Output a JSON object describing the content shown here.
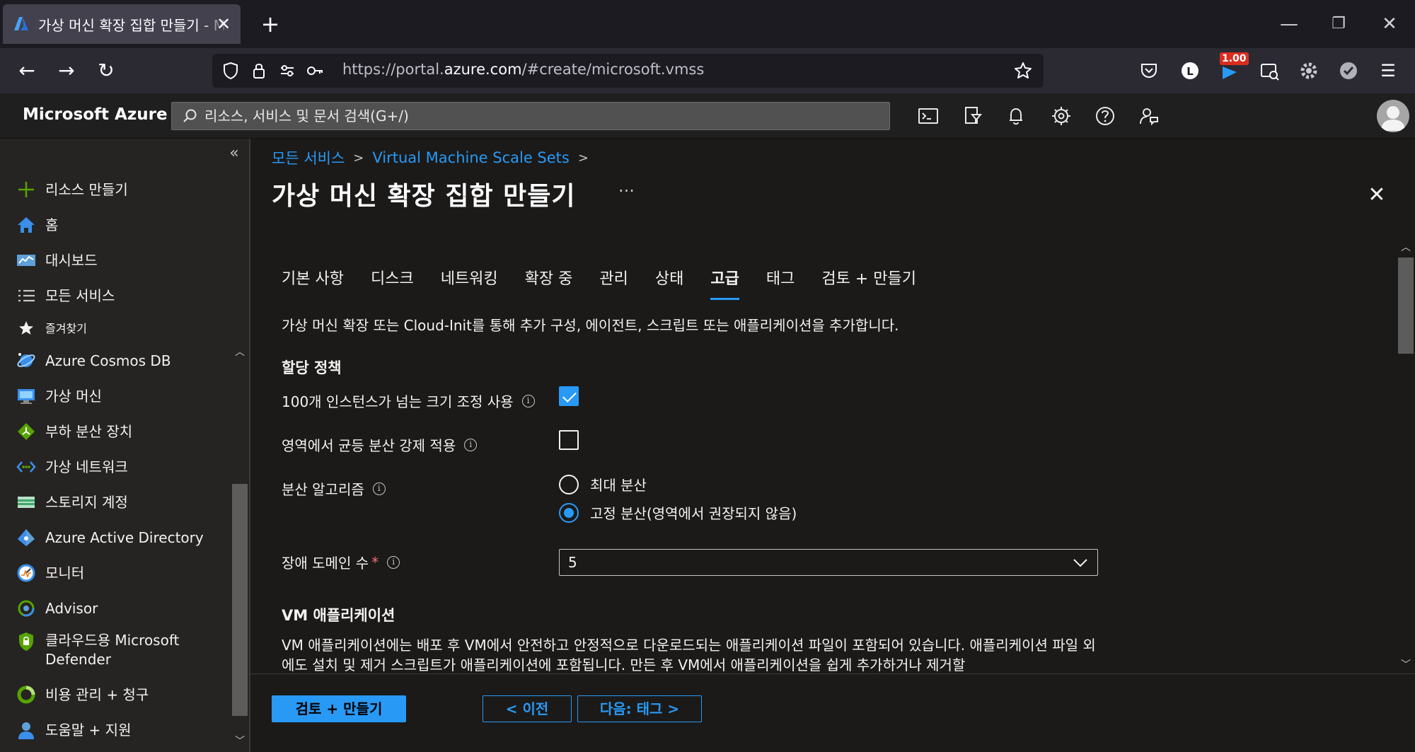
{
  "browser": {
    "tab_title": "가상 머신 확장 집합 만들기 - Microsoft Azure",
    "new_tab_label": "+",
    "url_prefix": "https://portal.",
    "url_domain": "azure.com",
    "url_path": "/#create/microsoft.vmss",
    "badge_value": "1.00"
  },
  "azure": {
    "brand": "Microsoft Azure",
    "search_placeholder": "리소스, 서비스 및 문서 검색(G+/)"
  },
  "sidebar": {
    "items": [
      {
        "label": "리소스 만들기",
        "icon": "plus-icon"
      },
      {
        "label": "홈",
        "icon": "home-icon"
      },
      {
        "label": "대시보드",
        "icon": "dashboard-icon"
      },
      {
        "label": "모든 서비스",
        "icon": "list-icon"
      },
      {
        "label": "즐겨찾기",
        "icon": "star-icon"
      },
      {
        "label": "Azure Cosmos DB",
        "icon": "cosmos-db-icon"
      },
      {
        "label": "가상 머신",
        "icon": "virtual-machine-icon"
      },
      {
        "label": "부하 분산 장치",
        "icon": "load-balancer-icon"
      },
      {
        "label": "가상 네트워크",
        "icon": "virtual-network-icon"
      },
      {
        "label": "스토리지 계정",
        "icon": "storage-account-icon"
      },
      {
        "label": "Azure Active Directory",
        "icon": "active-directory-icon"
      },
      {
        "label": "모니터",
        "icon": "monitor-icon"
      },
      {
        "label": "Advisor",
        "icon": "advisor-icon"
      },
      {
        "label": "클라우드용 Microsoft Defender",
        "icon": "defender-icon"
      },
      {
        "label": "비용 관리 + 청구",
        "icon": "cost-management-icon"
      },
      {
        "label": "도움말 + 지원",
        "icon": "help-support-icon"
      }
    ]
  },
  "breadcrumb": {
    "items": [
      "모든 서비스",
      "Virtual Machine Scale Sets"
    ]
  },
  "page": {
    "title": "가상 머신 확장 집합 만들기",
    "more": "···"
  },
  "tabs": [
    {
      "label": "기본 사항"
    },
    {
      "label": "디스크"
    },
    {
      "label": "네트워킹"
    },
    {
      "label": "확장 중"
    },
    {
      "label": "관리"
    },
    {
      "label": "상태"
    },
    {
      "label": "고급",
      "active": true
    },
    {
      "label": "태그"
    },
    {
      "label": "검토 + 만들기"
    }
  ],
  "form": {
    "intro": "가상 머신 확장 또는 Cloud-Init를 통해 추가 구성, 에이전트, 스크립트 또는 애플리케이션을 추가합니다.",
    "allocation_section": "할당 정책",
    "scale_beyond_100_label": "100개 인스턴스가 넘는 크기 조정 사용",
    "scale_beyond_100_checked": true,
    "zone_balance_label": "영역에서 균등 분산 강제 적용",
    "zone_balance_checked": false,
    "spreading_label": "분산 알고리즘",
    "spreading_options": [
      "최대 분산",
      "고정 분산(영역에서 권장되지 않음)"
    ],
    "spreading_selected": 1,
    "fault_domain_label": "장애 도메인 수",
    "fault_domain_required": "*",
    "fault_domain_value": "5",
    "vm_app_section": "VM 애플리케이션",
    "vm_app_desc": "VM 애플리케이션에는 배포 후 VM에서 안전하고 안정적으로 다운로드되는 애플리케이션 파일이 포함되어 있습니다. 애플리케이션 파일 외에도 설치 및 제거 스크립트가 애플리케이션에 포함됩니다. 만든 후 VM에서 애플리케이션을 쉽게 추가하거나 제거할"
  },
  "footer": {
    "review_create": "검토 + 만들기",
    "previous": "< 이전",
    "next": "다음: 태그 >"
  },
  "colors": {
    "accent": "#2899f5",
    "background": "#1b1a19",
    "sidebar": "#252423",
    "required": "#f1707b"
  }
}
